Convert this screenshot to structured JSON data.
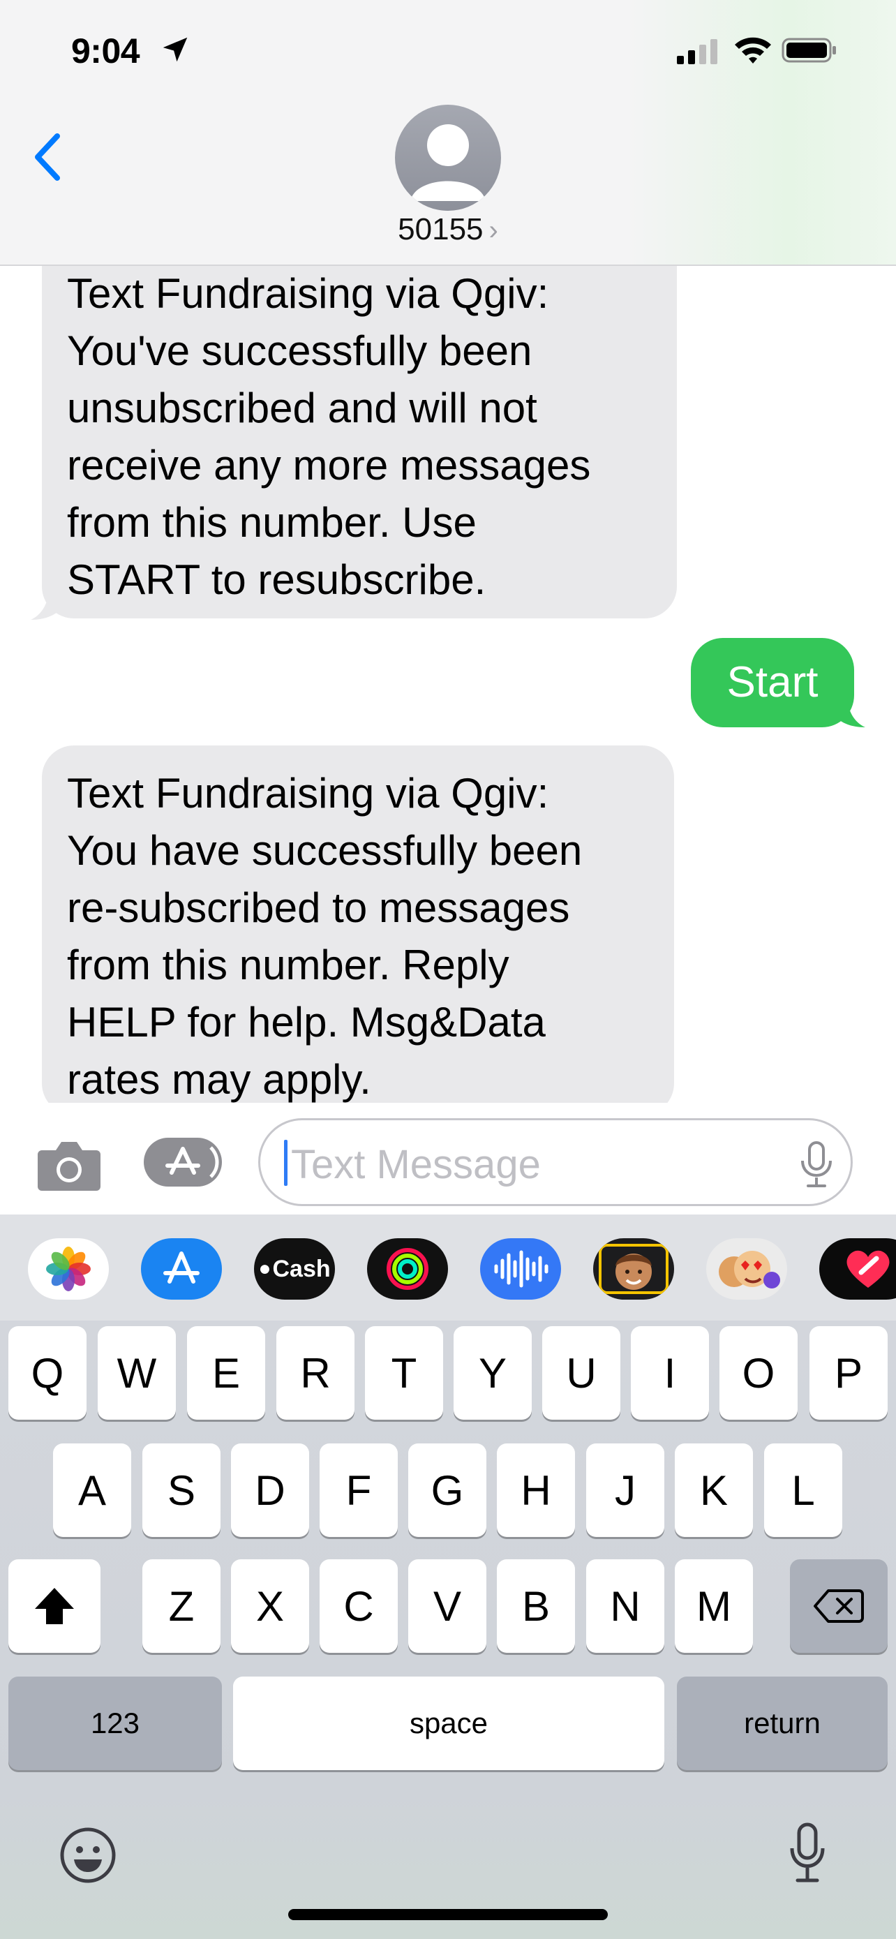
{
  "status_bar": {
    "time": "9:04"
  },
  "header": {
    "contact_name": "50155",
    "chevron": "›"
  },
  "messages": [
    {
      "direction": "incoming",
      "lines": [
        "Text Fundraising via Qgiv:",
        "You've successfully been",
        "unsubscribed and will not",
        "receive any more messages",
        "from this number. Use",
        "START to resubscribe."
      ]
    },
    {
      "direction": "outgoing",
      "lines": [
        "Start"
      ]
    },
    {
      "direction": "incoming",
      "lines": [
        "Text Fundraising via Qgiv:",
        "You have successfully been",
        "re-subscribed to messages",
        "from this number. Reply",
        "HELP for help. Msg&Data",
        "rates may apply."
      ]
    }
  ],
  "input": {
    "placeholder": "Text Message"
  },
  "app_strip": {
    "apps": [
      "photos-app-icon",
      "app-store-icon",
      "apple-cash-icon",
      "activity-icon",
      "audio-message-icon",
      "memoji-icon",
      "memoji-stickers-icon",
      "digital-touch-icon"
    ],
    "cash_label": "Cash"
  },
  "keyboard": {
    "row1": [
      "Q",
      "W",
      "E",
      "R",
      "T",
      "Y",
      "U",
      "I",
      "O",
      "P"
    ],
    "row2": [
      "A",
      "S",
      "D",
      "F",
      "G",
      "H",
      "J",
      "K",
      "L"
    ],
    "row3": [
      "Z",
      "X",
      "C",
      "V",
      "B",
      "N",
      "M"
    ],
    "numbers_label": "123",
    "space_label": "space",
    "return_label": "return"
  },
  "colors": {
    "accent": "#007aff",
    "outgoing_bubble": "#34c759",
    "incoming_bubble": "#e9e9eb"
  }
}
